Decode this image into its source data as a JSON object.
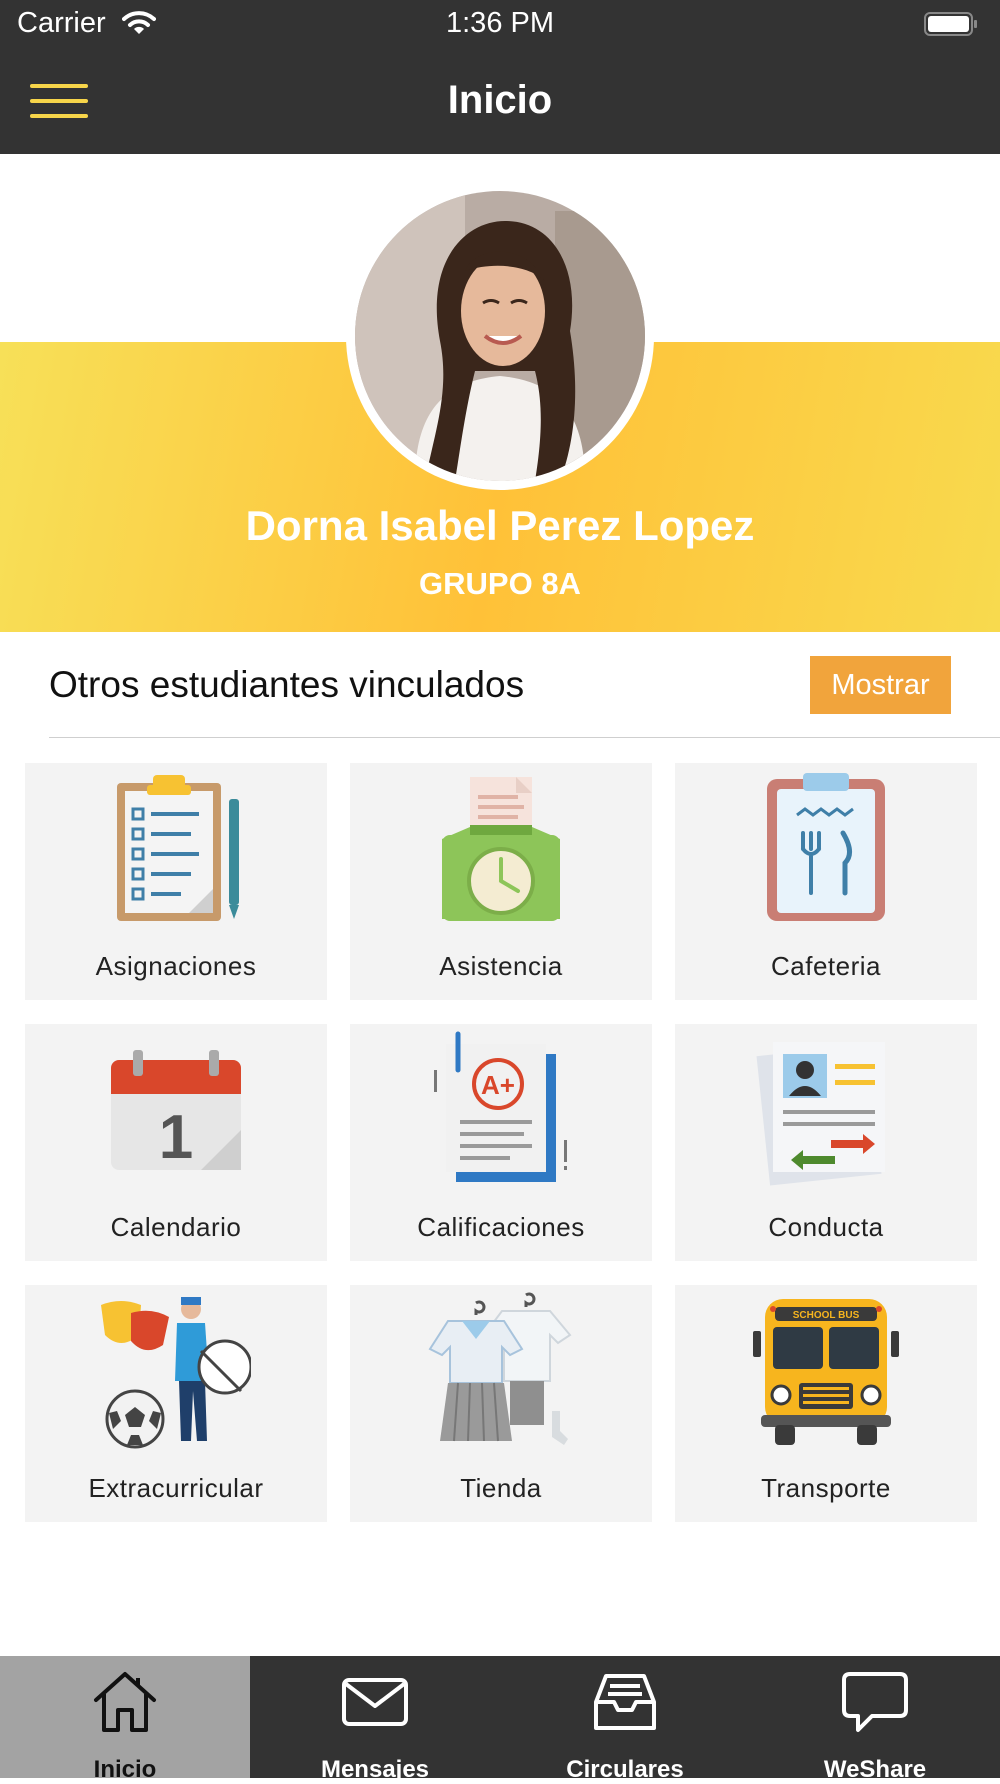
{
  "status_bar": {
    "carrier": "Carrier",
    "time": "1:36 PM"
  },
  "nav": {
    "title": "Inicio"
  },
  "profile": {
    "name": "Dorna Isabel Perez Lopez",
    "group": "GRUPO 8A"
  },
  "linked": {
    "label": "Otros estudiantes vinculados",
    "button": "Mostrar"
  },
  "tiles": [
    {
      "label": "Asignaciones",
      "icon": "clipboard-checklist-icon"
    },
    {
      "label": "Asistencia",
      "icon": "time-clock-icon"
    },
    {
      "label": "Cafeteria",
      "icon": "cafeteria-menu-icon"
    },
    {
      "label": "Calendario",
      "icon": "calendar-icon"
    },
    {
      "label": "Calificaciones",
      "icon": "grade-report-icon"
    },
    {
      "label": "Conducta",
      "icon": "conduct-report-icon"
    },
    {
      "label": "Extracurricular",
      "icon": "extracurricular-icon"
    },
    {
      "label": "Tienda",
      "icon": "uniform-store-icon"
    },
    {
      "label": "Transporte",
      "icon": "school-bus-icon"
    }
  ],
  "tabs": [
    {
      "label": "Inicio",
      "icon": "home-icon",
      "active": true
    },
    {
      "label": "Mensajes",
      "icon": "envelope-icon",
      "active": false
    },
    {
      "label": "Circulares",
      "icon": "inbox-tray-icon",
      "active": false
    },
    {
      "label": "WeShare",
      "icon": "chat-bubble-icon",
      "active": false
    }
  ],
  "colors": {
    "bar": "#333333",
    "accent": "#f7d54a",
    "button": "#f1a43c",
    "banner_start": "#f7e058",
    "banner_mid": "#ffc138"
  }
}
